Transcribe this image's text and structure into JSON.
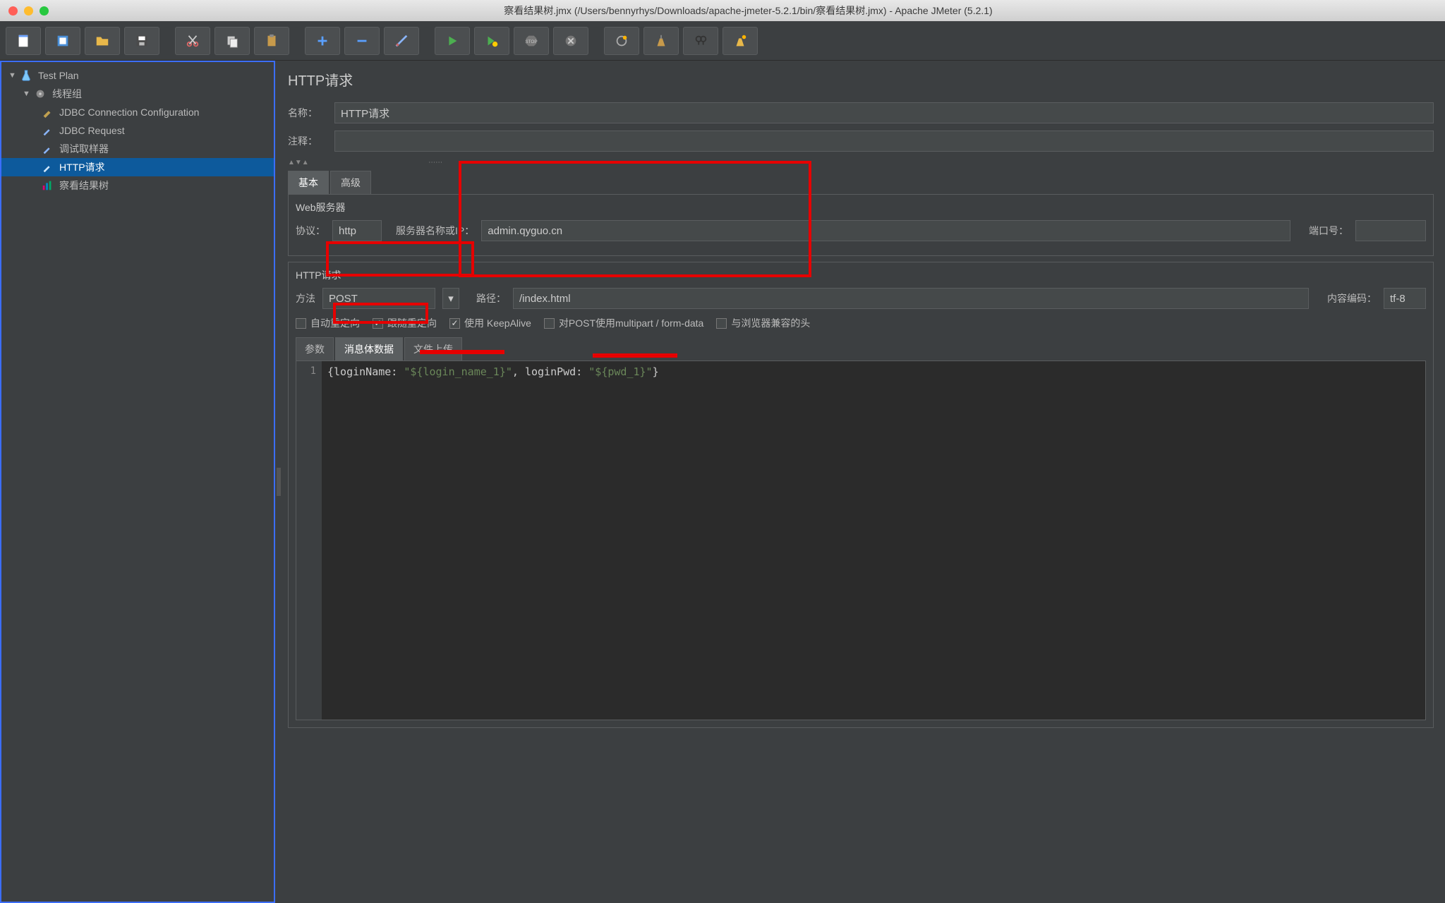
{
  "window": {
    "title": "察看结果树.jmx (/Users/bennyrhys/Downloads/apache-jmeter-5.2.1/bin/察看结果树.jmx) - Apache JMeter (5.2.1)"
  },
  "toolbar": {
    "new": "新建",
    "templates": "模板",
    "open": "打开",
    "save": "保存",
    "cut": "剪切",
    "copy": "复制",
    "paste": "粘贴",
    "expand": "+",
    "collapse": "−",
    "toggle": "切换",
    "start": "启动",
    "start_no_timers": "启动不计时",
    "stop": "停止",
    "shutdown": "关闭",
    "clear": "清除",
    "clear_all": "全部清除",
    "search": "查找",
    "reset_search": "重置查找"
  },
  "tree": {
    "root": "Test Plan",
    "thread_group": "线程组",
    "items": [
      "JDBC Connection Configuration",
      "JDBC Request",
      "调试取样器",
      "HTTP请求",
      "察看结果树"
    ]
  },
  "panel": {
    "title": "HTTP请求",
    "name_label": "名称：",
    "name_value": "HTTP请求",
    "comment_label": "注释：",
    "comment_value": "",
    "tab_basic": "基本",
    "tab_advanced": "高级",
    "web_server_group": "Web服务器",
    "protocol_label": "协议：",
    "protocol_value": "http",
    "server_label": "服务器名称或IP：",
    "server_value": "admin.qyguo.cn",
    "port_label": "端口号：",
    "port_value": "",
    "http_request_group": "HTTP请求",
    "method_label": "方法",
    "method_value": "POST",
    "path_label": "路径：",
    "path_value": "/index.html",
    "encoding_label": "内容编码：",
    "encoding_value": "tf-8",
    "chk_auto_redirect": "自动重定向",
    "chk_follow_redirect": "跟随重定向",
    "chk_keepalive": "使用 KeepAlive",
    "chk_multipart": "对POST使用multipart / form-data",
    "chk_browser_compat": "与浏览器兼容的头",
    "subtab_params": "参数",
    "subtab_body": "消息体数据",
    "subtab_files": "文件上传",
    "body_line_num": "1",
    "body_text_plain": "{loginName: \"${login_name_1}\", loginPwd: \"${pwd_1}\"}",
    "body_p1": "{loginName: ",
    "body_s1": "\"${login_name_1}\"",
    "body_p2": ", loginPwd: ",
    "body_s2": "\"${pwd_1}\"",
    "body_p3": "}"
  }
}
